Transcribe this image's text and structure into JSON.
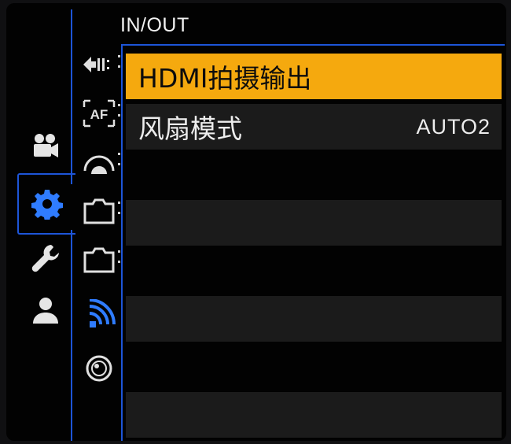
{
  "header": {
    "title": "IN/OUT"
  },
  "main_tabs": [
    {
      "icon": "video-camera-icon",
      "active": false
    },
    {
      "icon": "gear-icon",
      "active": true
    },
    {
      "icon": "wrench-icon",
      "active": false
    },
    {
      "icon": "person-icon",
      "active": false
    }
  ],
  "sub_tabs": [
    {
      "icon": "burst-arrows-icon",
      "active": false
    },
    {
      "icon": "af-icon",
      "label": "AF",
      "active": false
    },
    {
      "icon": "exposure-dial-icon",
      "active": false
    },
    {
      "icon": "camera-body-icon",
      "active": false
    },
    {
      "icon": "camera-body-icon-2",
      "active": false
    },
    {
      "icon": "wireless-icon",
      "active": true
    },
    {
      "icon": "lens-ring-icon",
      "active": false
    }
  ],
  "menu": {
    "items": [
      {
        "label": "HDMI拍摄输出",
        "value": "",
        "selected": true
      },
      {
        "label": "风扇模式",
        "value": "AUTO2",
        "selected": false
      }
    ]
  },
  "colors": {
    "accent_blue": "#1d55d8",
    "highlight_orange": "#f5a90e",
    "row_alt": "#1b1b1b"
  }
}
